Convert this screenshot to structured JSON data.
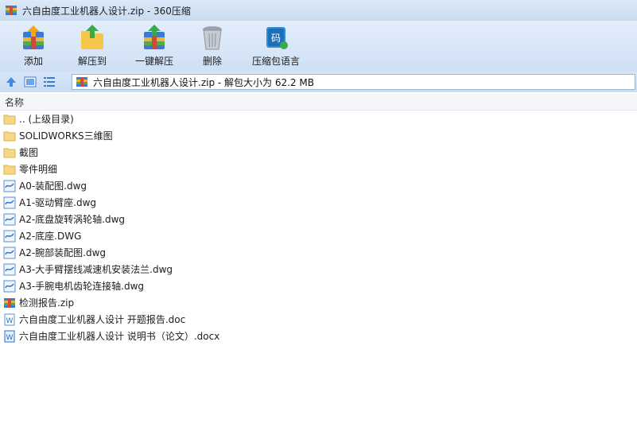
{
  "window": {
    "title": "六自由度工业机器人设计.zip - 360压缩"
  },
  "toolbar": {
    "items": [
      {
        "label": "添加",
        "icon": "add-archive-icon"
      },
      {
        "label": "解压到",
        "icon": "extract-to-icon"
      },
      {
        "label": "一键解压",
        "icon": "one-click-extract-icon"
      },
      {
        "label": "删除",
        "icon": "delete-bin-icon"
      },
      {
        "label": "压缩包语言",
        "icon": "archive-language-icon"
      }
    ]
  },
  "address": {
    "text": "六自由度工业机器人设计.zip - 解包大小为 62.2 MB"
  },
  "columns": {
    "name": "名称"
  },
  "files": [
    {
      "name": ".. (上级目录)",
      "type": "folder"
    },
    {
      "name": "SOLIDWORKS三维图",
      "type": "folder"
    },
    {
      "name": "截图",
      "type": "folder"
    },
    {
      "name": "零件明细",
      "type": "folder"
    },
    {
      "name": "A0-装配图.dwg",
      "type": "dwg"
    },
    {
      "name": "A1-驱动臂座.dwg",
      "type": "dwg"
    },
    {
      "name": "A2-底盘旋转涡轮轴.dwg",
      "type": "dwg"
    },
    {
      "name": "A2-底座.DWG",
      "type": "dwg"
    },
    {
      "name": "A2-腕部装配图.dwg",
      "type": "dwg"
    },
    {
      "name": "A3-大手臂摆线减速机安装法兰.dwg",
      "type": "dwg"
    },
    {
      "name": "A3-手腕电机齿轮连接轴.dwg",
      "type": "dwg"
    },
    {
      "name": "检测报告.zip",
      "type": "zip"
    },
    {
      "name": "六自由度工业机器人设计 开题报告.doc",
      "type": "doc"
    },
    {
      "name": "六自由度工业机器人设计 说明书（论文）.docx",
      "type": "docx"
    }
  ],
  "colors": {
    "titlebar": "#c9dcf2",
    "folder": "#f6d784",
    "accent": "#2b6cc4"
  }
}
